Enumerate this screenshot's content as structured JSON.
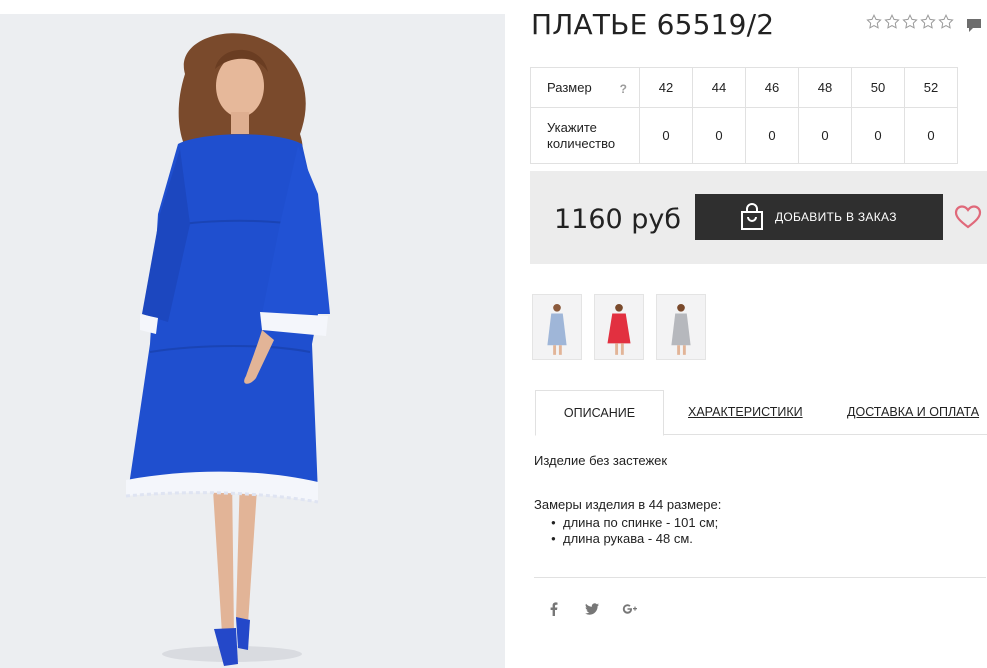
{
  "product": {
    "title": "ПЛАТЬЕ 65519/2",
    "rating_stars": 5,
    "rating_value": 0
  },
  "sizes": {
    "row_label": "Размер",
    "help_mark": "?",
    "qty_label": "Укажите количество",
    "values": [
      "42",
      "44",
      "46",
      "48",
      "50",
      "52"
    ],
    "quantities": [
      "0",
      "0",
      "0",
      "0",
      "0",
      "0"
    ]
  },
  "purchase": {
    "price": "1160 руб",
    "order_button": "ДОБАВИТЬ В ЗАКАЗ"
  },
  "thumbnails": [
    {
      "color": "#9fb6d8"
    },
    {
      "color": "#e23040"
    },
    {
      "color": "#b6b8bd"
    }
  ],
  "tabs": [
    {
      "label": "ОПИСАНИЕ",
      "active": true
    },
    {
      "label": "ХАРАКТЕРИСТИКИ",
      "active": false
    },
    {
      "label": "ДОСТАВКА И ОПЛАТА",
      "active": false
    }
  ],
  "description": {
    "line1": "Изделие без застежек",
    "line2": "Замеры изделия в 44 размере:",
    "bullets": [
      "длина по спинке - 101 см;",
      "длина рукава - 48 см."
    ]
  },
  "social": [
    "facebook-icon",
    "twitter-icon",
    "google-plus-icon"
  ],
  "colors": {
    "dress": "#1f4fcf",
    "button_bg": "#2f2f2f",
    "heart": "#e0697a"
  }
}
